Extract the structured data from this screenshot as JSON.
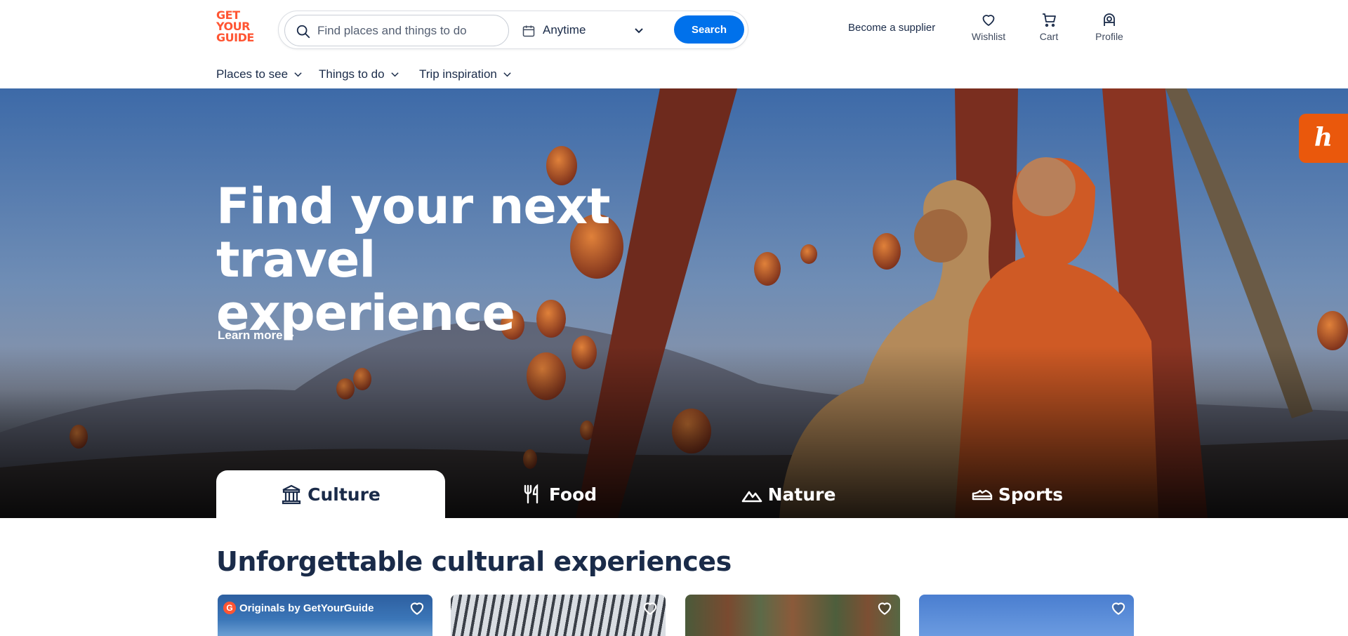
{
  "brand": {
    "logo_lines": [
      "GET",
      "YOUR",
      "GUIDE"
    ],
    "accent_color": "#ff5533",
    "primary_color": "#0071eb"
  },
  "search": {
    "placeholder": "Find places and things to do",
    "value": "",
    "date_label": "Anytime",
    "button_label": "Search"
  },
  "header": {
    "supplier_link": "Become a supplier",
    "wishlist_label": "Wishlist",
    "cart_label": "Cart",
    "profile_label": "Profile"
  },
  "subnav": {
    "places": "Places to see",
    "things": "Things to do",
    "trip": "Trip inspiration"
  },
  "hero": {
    "title_line1": "Find your next travel",
    "title_line2": "experience",
    "learn_more": "Learn more",
    "extension_glyph": "h"
  },
  "tabs": [
    {
      "label": "Culture",
      "icon": "culture-icon",
      "active": true
    },
    {
      "label": "Food",
      "icon": "food-icon",
      "active": false
    },
    {
      "label": "Nature",
      "icon": "nature-icon",
      "active": false
    },
    {
      "label": "Sports",
      "icon": "sports-icon",
      "active": false
    }
  ],
  "section": {
    "title": "Unforgettable cultural experiences",
    "cards": [
      {
        "badge": "Originals by GetYourGuide",
        "badge_glyph": "G"
      },
      {
        "badge": ""
      },
      {
        "badge": ""
      },
      {
        "badge": ""
      }
    ]
  }
}
